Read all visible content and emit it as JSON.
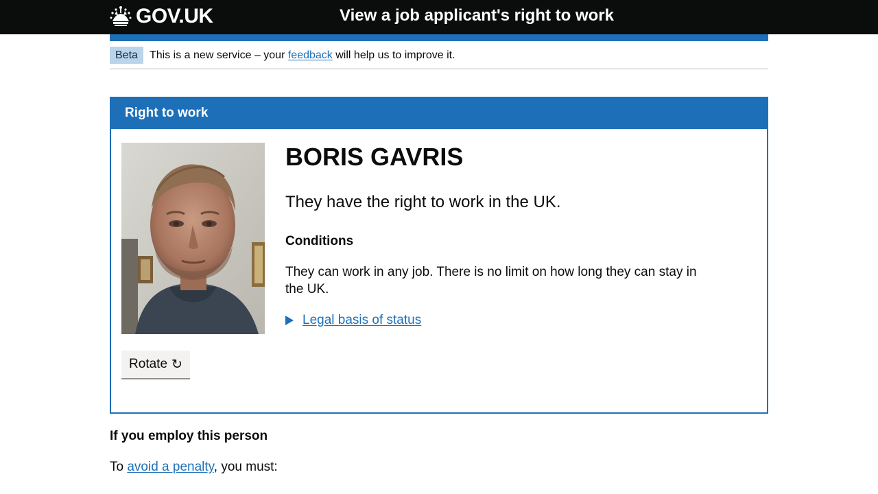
{
  "header": {
    "logo_text": "GOV.UK",
    "service_name": "View a job applicant's right to work"
  },
  "phase_banner": {
    "tag": "Beta",
    "text_before": "This is a new service – your",
    "link_text": "feedback",
    "text_after": "will help us to improve it."
  },
  "panel": {
    "title": "Right to work",
    "person_name": "BORIS GAVRIS",
    "status": "They have the right to work in the UK.",
    "conditions_heading": "Conditions",
    "conditions_text": "They can work in any job. There is no limit on how long they can stay in the UK.",
    "details_summary": "Legal basis of status",
    "rotate_label": "Rotate",
    "rotate_glyph": "↻"
  },
  "employ": {
    "heading": "If you employ this person",
    "text_before": "To",
    "link_text": "avoid a penalty",
    "text_after": ", you must:"
  },
  "colors": {
    "header_bg": "#0b0c0c",
    "brand_blue": "#1d70b8",
    "tag_bg": "#bbd4ea",
    "button_bg": "#f3f2f1"
  }
}
